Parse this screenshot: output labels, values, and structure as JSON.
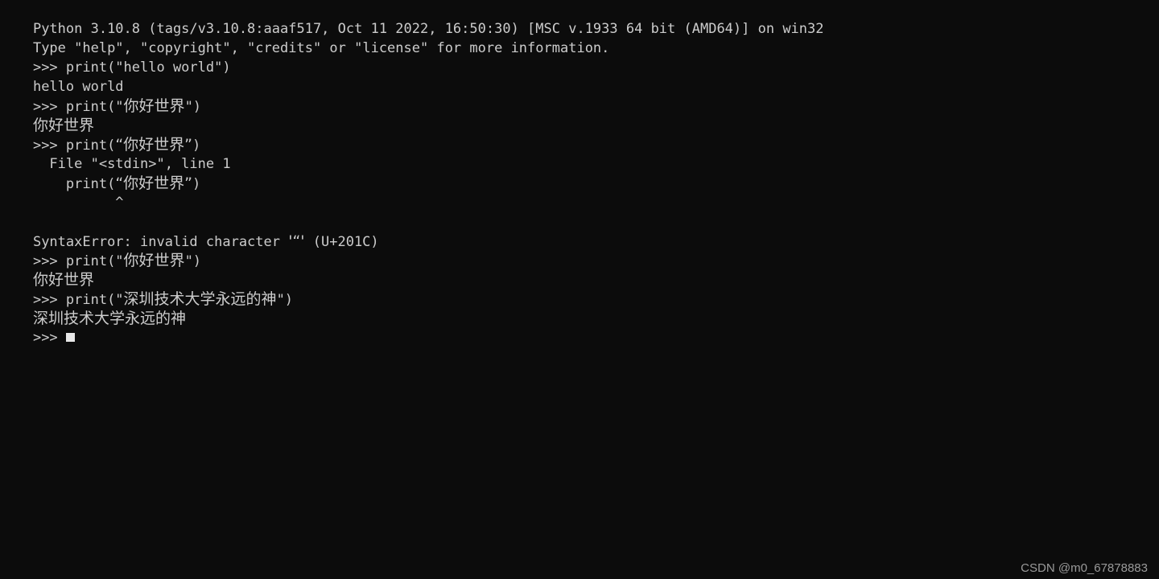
{
  "window": {
    "kind": "python-interactive-shell",
    "background_color": "#0c0c0c",
    "foreground_color": "#cccccc",
    "cursor_color": "#e8e8e8"
  },
  "terminal": {
    "banner": {
      "version_line": "Python 3.10.8 (tags/v3.10.8:aaaf517, Oct 11 2022, 16:50:30) [MSC v.1933 64 bit (AMD64)] on win32",
      "help_line": "Type \"help\", \"copyright\", \"credits\" or \"license\" for more information."
    },
    "prompt": ">>>",
    "lines": [
      {
        "id": "line-1",
        "type": "banner",
        "text": "Python 3.10.8 (tags/v3.10.8:aaaf517, Oct 11 2022, 16:50:30) [MSC v.1933 64 bit (AMD64)] on win32"
      },
      {
        "id": "line-2",
        "type": "banner",
        "text": "Type \"help\", \"copyright\", \"credits\" or \"license\" for more information."
      },
      {
        "id": "line-3",
        "type": "input",
        "text": ">>> print(\"hello world\")"
      },
      {
        "id": "line-4",
        "type": "output",
        "text": "hello world"
      },
      {
        "id": "line-5",
        "type": "input",
        "text": ">>> print(\"你好世界\")"
      },
      {
        "id": "line-6",
        "type": "output",
        "text": "你好世界"
      },
      {
        "id": "line-7",
        "type": "input",
        "text": ">>> print(“你好世界”)"
      },
      {
        "id": "line-8",
        "type": "traceback",
        "text": "  File \"<stdin>\", line 1"
      },
      {
        "id": "line-9",
        "type": "traceback",
        "text": "    print(“你好世界”)"
      },
      {
        "id": "line-10",
        "type": "caret",
        "text": "          ^"
      },
      {
        "id": "line-11",
        "type": "blank",
        "text": ""
      },
      {
        "id": "line-12",
        "type": "error",
        "text": "SyntaxError: invalid character '“' (U+201C)"
      },
      {
        "id": "line-13",
        "type": "input",
        "text": ">>> print(\"你好世界\")"
      },
      {
        "id": "line-14",
        "type": "output",
        "text": "你好世界"
      },
      {
        "id": "line-15",
        "type": "input",
        "text": ">>> print(\"深圳技术大学永远的神\")"
      },
      {
        "id": "line-16",
        "type": "output",
        "text": "深圳技术大学永远的神"
      },
      {
        "id": "line-17",
        "type": "prompt",
        "text": ">>> "
      }
    ],
    "error": {
      "exception": "SyntaxError",
      "message": "invalid character '“' (U+201C)",
      "file": "<stdin>",
      "line_number": "1",
      "offending_codepoint": "U+201C"
    },
    "segments": {
      "l3_pre": ">>> print(\"hello world\")",
      "l4_out": "hello world",
      "l5_a": ">>> print(\"",
      "l5_cjk": "你好世界",
      "l5_b": "\")",
      "l6_cjk": "你好世界",
      "l7_a": ">>> print(",
      "l7_q1": "“",
      "l7_cjk": "你好世界",
      "l7_q2": "”",
      "l7_b": ")",
      "l8": "  File \"<stdin>\", line 1",
      "l9_a": "    print(",
      "l9_q1": "“",
      "l9_cjk": "你好世界",
      "l9_q2": "”",
      "l9_b": ")",
      "l10_caret": "^",
      "l12_a": "SyntaxError: invalid character ",
      "l12_q": "'“'",
      "l12_b": " (U+201C)",
      "l13_a": ">>> print(\"",
      "l13_cjk": "你好世界",
      "l13_b": "\")",
      "l14_cjk": "你好世界",
      "l15_a": ">>> print(\"",
      "l15_cjk": "深圳技术大学永远的神",
      "l15_b": "\")",
      "l16_cjk": "深圳技术大学永远的神",
      "l17_prompt": ">>>"
    }
  },
  "watermark": {
    "text": "CSDN @m0_67878883"
  }
}
